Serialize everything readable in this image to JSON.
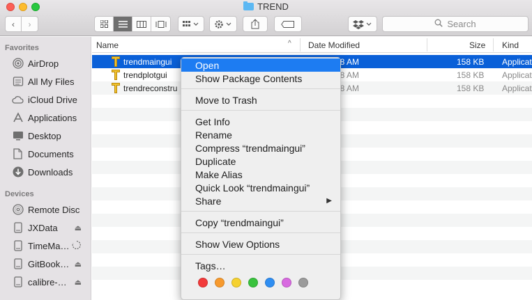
{
  "window": {
    "title": "TREND",
    "controls": {
      "close_color": "#fc5f57",
      "minimize_color": "#fdbc2e",
      "maximize_color": "#28c840"
    }
  },
  "toolbar": {
    "back_glyph": "‹",
    "forward_glyph": "›",
    "views": [
      "icon-view",
      "list-view",
      "column-view",
      "cover-flow-view"
    ],
    "active_view": "list-view",
    "search_placeholder": "Search"
  },
  "sidebar": {
    "favorites_heading": "Favorites",
    "favorites": [
      {
        "label": "AirDrop",
        "icon": "airdrop-icon"
      },
      {
        "label": "All My Files",
        "icon": "all-files-icon"
      },
      {
        "label": "iCloud Drive",
        "icon": "cloud-icon"
      },
      {
        "label": "Applications",
        "icon": "applications-icon"
      },
      {
        "label": "Desktop",
        "icon": "desktop-icon"
      },
      {
        "label": "Documents",
        "icon": "document-icon"
      },
      {
        "label": "Downloads",
        "icon": "download-icon"
      }
    ],
    "devices_heading": "Devices",
    "devices": [
      {
        "label": "Remote Disc",
        "icon": "disc-icon"
      },
      {
        "label": "JXData",
        "icon": "drive-icon",
        "eject": true
      },
      {
        "label": "TimeMa…",
        "icon": "drive-icon",
        "busy": true
      },
      {
        "label": "GitBook…",
        "icon": "drive-icon",
        "eject": true
      },
      {
        "label": "calibre-…",
        "icon": "drive-icon",
        "eject": true
      }
    ]
  },
  "list": {
    "columns": {
      "name": "Name",
      "date": "Date Modified",
      "size": "Size",
      "kind": "Kind"
    },
    "rows": [
      {
        "name": "trendmaingui",
        "date": "38 AM",
        "size": "158 KB",
        "kind": "Applicati"
      },
      {
        "name": "trendplotgui",
        "date": "38 AM",
        "size": "158 KB",
        "kind": "Applicati"
      },
      {
        "name": "trendreconstru",
        "date": "38 AM",
        "size": "158 KB",
        "kind": "Applicati"
      }
    ]
  },
  "context_menu": {
    "items": [
      "Open",
      "Show Package Contents",
      "Move to Trash",
      "Get Info",
      "Rename",
      "Compress “trendmaingui”",
      "Duplicate",
      "Make Alias",
      "Quick Look “trendmaingui”",
      "Share",
      "Copy “trendmaingui”",
      "Show View Options",
      "Tags…"
    ],
    "highlighted": "Open",
    "tag_colors": [
      "#f23a3a",
      "#f79a2e",
      "#f5d130",
      "#39c23d",
      "#2f8ef2",
      "#d86ae0",
      "#9b9b9b"
    ]
  }
}
